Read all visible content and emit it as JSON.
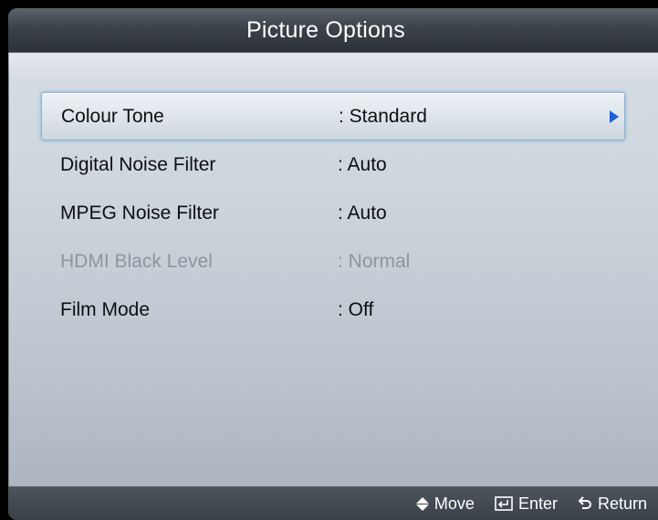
{
  "window": {
    "title": "Picture Options"
  },
  "menu": {
    "items": [
      {
        "label": "Colour Tone",
        "value": ": Standard",
        "selected": true,
        "enabled": true
      },
      {
        "label": "Digital Noise Filter",
        "value": ": Auto",
        "selected": false,
        "enabled": true
      },
      {
        "label": "MPEG Noise Filter",
        "value": ": Auto",
        "selected": false,
        "enabled": true
      },
      {
        "label": "HDMI Black Level",
        "value": ": Normal",
        "selected": false,
        "enabled": false
      },
      {
        "label": "Film Mode",
        "value": ": Off",
        "selected": false,
        "enabled": true
      }
    ]
  },
  "footer": {
    "move_label": "Move",
    "enter_label": "Enter",
    "return_label": "Return",
    "icons": [
      "up-down-arrows-icon",
      "enter-icon",
      "return-icon"
    ]
  },
  "colors": {
    "title_bar": "#3b4249",
    "selection_border": "#8fb2d6",
    "arrow": "#1a5fd6",
    "disabled_text": "#8d969f"
  }
}
